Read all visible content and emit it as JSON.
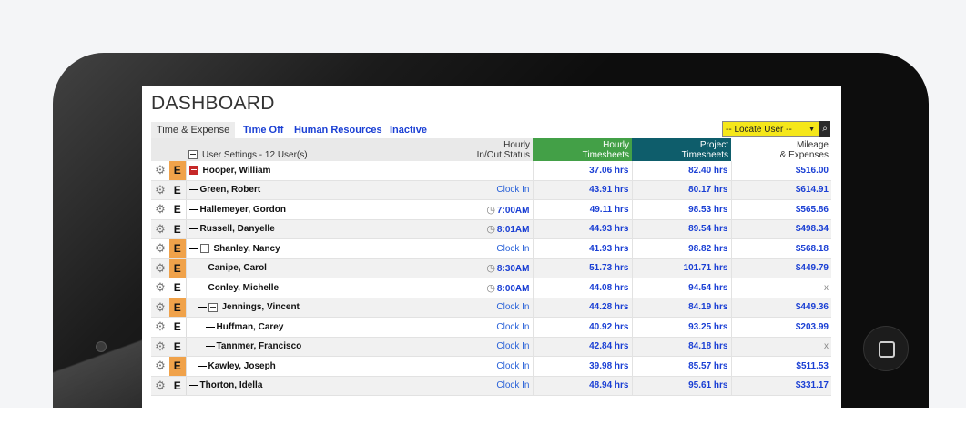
{
  "dashboard": {
    "title": "DASHBOARD",
    "tabs": [
      "Time & Expense",
      "Time Off",
      "Human Resources",
      "Inactive"
    ],
    "locate_user": "-- Locate User --",
    "columns": {
      "user_settings": "User Settings - 12 User(s)",
      "inout_l1": "Hourly",
      "inout_l2": "In/Out Status",
      "hourly_l1": "Hourly",
      "hourly_l2": "Timesheets",
      "project_l1": "Project",
      "project_l2": "Timesheets",
      "mileage_l1": "Mileage",
      "mileage_l2": "& Expenses"
    },
    "rows": [
      {
        "name": "Hooper, William",
        "status": "",
        "hourly": "37.06 hrs",
        "project": "82.40 hrs",
        "mileage": "$516.00"
      },
      {
        "name": "Green, Robert",
        "status": "Clock In",
        "hourly": "43.91 hrs",
        "project": "80.17 hrs",
        "mileage": "$614.91"
      },
      {
        "name": "Hallemeyer, Gordon",
        "status": "7:00AM",
        "hourly": "49.11 hrs",
        "project": "98.53 hrs",
        "mileage": "$565.86"
      },
      {
        "name": "Russell, Danyelle",
        "status": "8:01AM",
        "hourly": "44.93 hrs",
        "project": "89.54 hrs",
        "mileage": "$498.34"
      },
      {
        "name": "Shanley, Nancy",
        "status": "Clock In",
        "hourly": "41.93 hrs",
        "project": "98.82 hrs",
        "mileage": "$568.18"
      },
      {
        "name": "Canipe, Carol",
        "status": "8:30AM",
        "hourly": "51.73 hrs",
        "project": "101.71 hrs",
        "mileage": "$449.79"
      },
      {
        "name": "Conley, Michelle",
        "status": "8:00AM",
        "hourly": "44.08 hrs",
        "project": "94.54 hrs",
        "mileage": "x"
      },
      {
        "name": "Jennings, Vincent",
        "status": "Clock In",
        "hourly": "44.28 hrs",
        "project": "84.19 hrs",
        "mileage": "$449.36"
      },
      {
        "name": "Huffman, Carey",
        "status": "Clock In",
        "hourly": "40.92 hrs",
        "project": "93.25 hrs",
        "mileage": "$203.99"
      },
      {
        "name": "Tannmer, Francisco",
        "status": "Clock In",
        "hourly": "42.84 hrs",
        "project": "84.18 hrs",
        "mileage": "x"
      },
      {
        "name": "Kawley, Joseph",
        "status": "Clock In",
        "hourly": "39.98 hrs",
        "project": "85.57 hrs",
        "mileage": "$511.53"
      },
      {
        "name": "Thorton, Idella",
        "status": "Clock In",
        "hourly": "48.94 hrs",
        "project": "95.61 hrs",
        "mileage": "$331.17"
      }
    ],
    "employee_badge": "E"
  },
  "colors": {
    "hourly_header": "#43a047",
    "project_header": "#0e5d6b",
    "locate_bg": "#f5e71a",
    "badge_highlight": "#f0a24a",
    "link": "#1a3fd4"
  }
}
